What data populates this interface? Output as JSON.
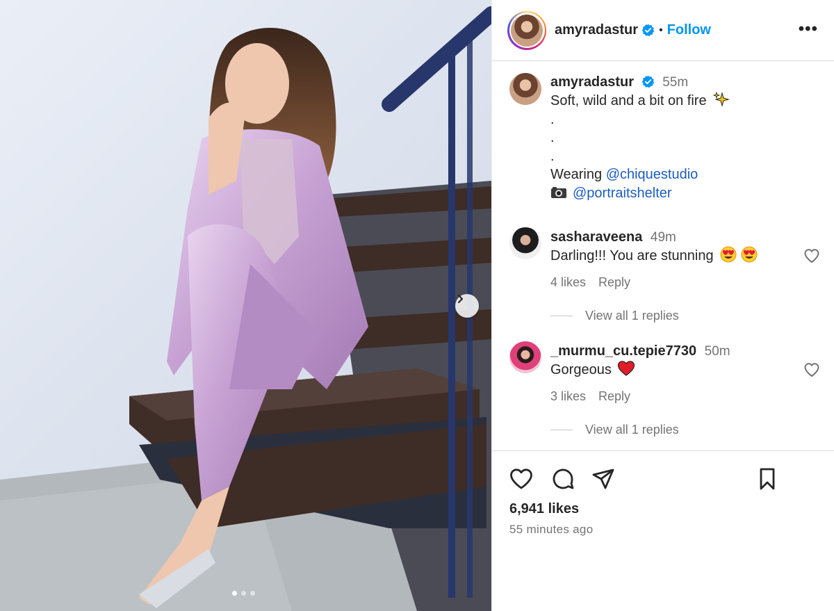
{
  "post": {
    "username": "amyradastur",
    "follow_label": "Follow",
    "more_label": "•••",
    "separator": "•"
  },
  "caption": {
    "username": "amyradastur",
    "time": "55m",
    "line1": "Soft, wild and a bit on fire",
    "line1_emoji": "sparkles",
    "dots": [
      ".",
      ".",
      "."
    ],
    "wearing_prefix": "Wearing",
    "wearing_mention": "@chiquestudio",
    "camera_emoji": "camera",
    "camera_mention": "@portraitshelter"
  },
  "comments": [
    {
      "username": "sasharaveena",
      "time": "49m",
      "text": "Darling!!! You are stunning",
      "emoji": "heart-eyes heart-eyes",
      "likes": "4 likes",
      "reply_label": "Reply",
      "view_replies": "View all 1 replies"
    },
    {
      "username": "_murmu_cu.tepie7730",
      "time": "50m",
      "text": "Gorgeous",
      "emoji": "red-heart",
      "likes": "3 likes",
      "reply_label": "Reply",
      "view_replies": "View all 1 replies"
    }
  ],
  "footer": {
    "likes": "6,941 likes",
    "time_ago": "55 minutes ago"
  },
  "carousel": {
    "dots": 3,
    "active_index": 0
  },
  "colors": {
    "follow_blue": "#0095f6",
    "mention_blue": "#1c5dbf",
    "verified_blue": "#0095f6",
    "outfit_lilac": "#c9a6d6",
    "stair_wood": "#3e2c26"
  }
}
